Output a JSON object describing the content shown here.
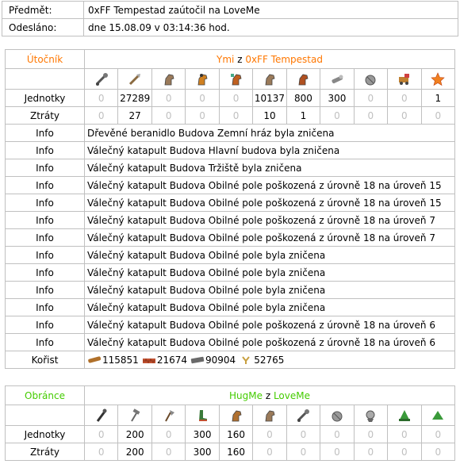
{
  "header": {
    "subject_label": "Předmět:",
    "subject_value": "0xFF Tempestad zaútočil na LoveMe",
    "sent_label": "Odesláno:",
    "sent_value": "dne 15.08.09 v 03:14:36 hod."
  },
  "attacker": {
    "role_label": "Útočník",
    "player": "Ymi",
    "from_word": " z ",
    "village": "0xFF Tempestad",
    "unit_icons": [
      "battering-ram-icon",
      "sword-icon",
      "horse-icon",
      "horse-rider-icon",
      "horse-knight-icon",
      "horse-icon",
      "horse-cavalry-icon",
      "catapult-log-icon",
      "trebuchet-icon",
      "settler-cart-icon",
      "chief-hat-icon",
      "hero-star-icon"
    ],
    "units_label": "Jednotky",
    "units": [
      "0",
      "27289",
      "0",
      "0",
      "0",
      "10137",
      "800",
      "300",
      "0",
      "0",
      "1"
    ],
    "losses_label": "Ztráty",
    "losses": [
      "0",
      "27",
      "0",
      "0",
      "0",
      "10",
      "1",
      "0",
      "0",
      "0",
      "0"
    ],
    "info_label": "Info",
    "info": [
      "Dřevěné beranidlo Budova Zemní hráz byla zničena",
      "Válečný katapult Budova Hlavní budova byla zničena",
      "Válečný katapult Budova Tržiště byla zničena",
      "Válečný katapult Budova Obilné pole poškozená z úrovně 18 na úroveň 15",
      "Válečný katapult Budova Obilné pole poškozená z úrovně 18 na úroveň 15",
      "Válečný katapult Budova Obilné pole poškozená z úrovně 18 na úroveň 7",
      "Válečný katapult Budova Obilné pole poškozená z úrovně 18 na úroveň 7",
      "Válečný katapult Budova Obilné pole byla zničena",
      "Válečný katapult Budova Obilné pole byla zničena",
      "Válečný katapult Budova Obilné pole byla zničena",
      "Válečný katapult Budova Obilné pole byla zničena",
      "Válečný katapult Budova Obilné pole poškozená z úrovně 18 na úroveň 6",
      "Válečný katapult Budova Obilné pole poškozená z úrovně 18 na úroveň 6"
    ],
    "loot_label": "Kořist",
    "loot": [
      {
        "icon": "wood-icon",
        "value": "115851"
      },
      {
        "icon": "clay-icon",
        "value": "21674"
      },
      {
        "icon": "iron-icon",
        "value": "90904"
      },
      {
        "icon": "crop-icon",
        "value": "52765"
      }
    ]
  },
  "defender": {
    "role_label": "Obránce",
    "player": "HugMe",
    "from_word": " z ",
    "village": "LoveMe",
    "unit_icons": [
      "club-icon",
      "hammer-icon",
      "axe-icon",
      "boot-icon",
      "helmet-horse-icon",
      "horse-icon",
      "battering-ram-icon",
      "trebuchet-icon",
      "chief-icon",
      "settler-hat-icon",
      "hero-icon"
    ],
    "units_label": "Jednotky",
    "units": [
      "0",
      "200",
      "0",
      "300",
      "160",
      "0",
      "0",
      "0",
      "0",
      "0",
      "0"
    ],
    "losses_label": "Ztráty",
    "losses": [
      "0",
      "200",
      "0",
      "300",
      "160",
      "0",
      "0",
      "0",
      "0",
      "0",
      "0"
    ]
  },
  "colors": {
    "attacker_accent": "#ff7700",
    "defender_accent": "#44cc00",
    "zero_text": "#c0c0c0",
    "border": "#c0c0c0"
  }
}
